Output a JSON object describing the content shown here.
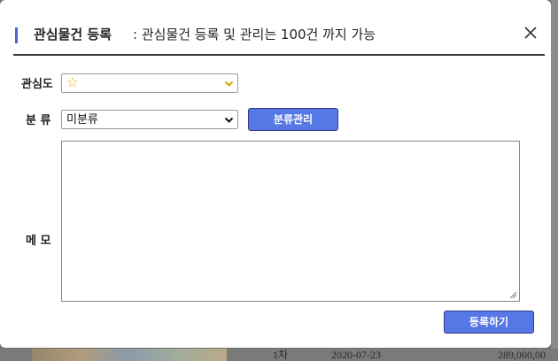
{
  "background": {
    "row_rank": "1차",
    "row_date": "2020-07-23",
    "row_price": "289,000,00"
  },
  "dialog": {
    "title": "관심물건 등록",
    "note": ": 관심물건 등록 및 관리는 100건 까지 가능",
    "close_icon": "close-icon"
  },
  "form": {
    "interest_label": "관심도",
    "interest_value": "☆",
    "category_label": "분 류",
    "category_value": "미분류",
    "category_manage_button": "분류관리",
    "memo_label": "메 모",
    "memo_value": "",
    "submit_button": "등록하기"
  },
  "colors": {
    "accent": "#4e66d6",
    "button": "#5677e6",
    "star": "#e0a200"
  }
}
